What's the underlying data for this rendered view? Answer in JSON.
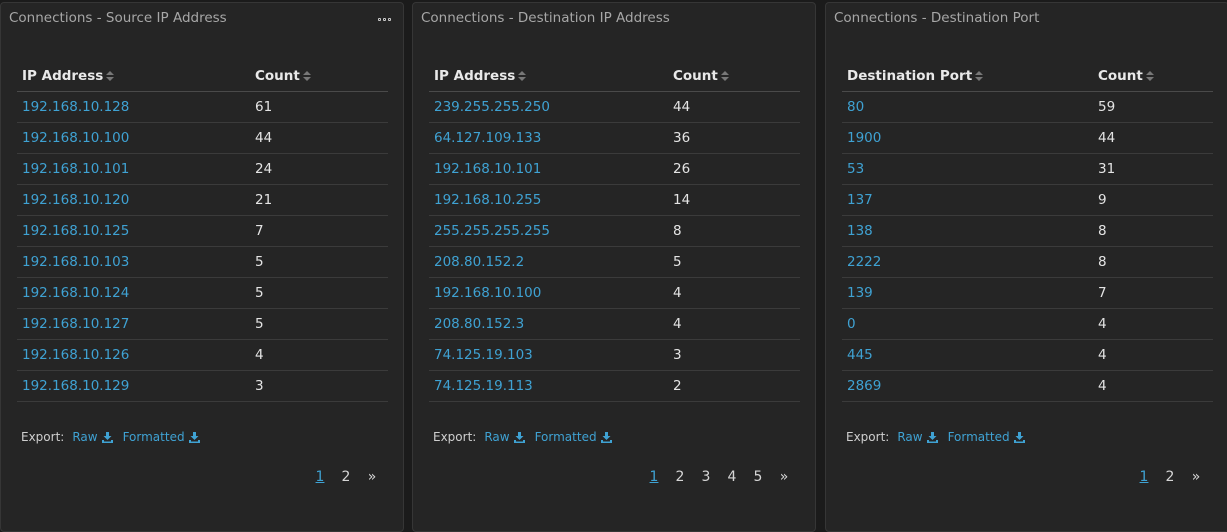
{
  "colors": {
    "accent": "#3fa2d3",
    "panel_bg": "#252525",
    "page_bg": "#1b1b1b"
  },
  "panels": [
    {
      "title": "Connections - Source IP Address",
      "col1": "IP Address",
      "col2": "Count",
      "rows": [
        [
          "192.168.10.128",
          "61"
        ],
        [
          "192.168.10.100",
          "44"
        ],
        [
          "192.168.10.101",
          "24"
        ],
        [
          "192.168.10.120",
          "21"
        ],
        [
          "192.168.10.125",
          "7"
        ],
        [
          "192.168.10.103",
          "5"
        ],
        [
          "192.168.10.124",
          "5"
        ],
        [
          "192.168.10.127",
          "5"
        ],
        [
          "192.168.10.126",
          "4"
        ],
        [
          "192.168.10.129",
          "3"
        ]
      ],
      "export_label": "Export:",
      "raw": "Raw",
      "formatted": "Formatted",
      "pages": [
        "1",
        "2",
        "»"
      ]
    },
    {
      "title": "Connections - Destination IP Address",
      "col1": "IP Address",
      "col2": "Count",
      "rows": [
        [
          "239.255.255.250",
          "44"
        ],
        [
          "64.127.109.133",
          "36"
        ],
        [
          "192.168.10.101",
          "26"
        ],
        [
          "192.168.10.255",
          "14"
        ],
        [
          "255.255.255.255",
          "8"
        ],
        [
          "208.80.152.2",
          "5"
        ],
        [
          "192.168.10.100",
          "4"
        ],
        [
          "208.80.152.3",
          "4"
        ],
        [
          "74.125.19.103",
          "3"
        ],
        [
          "74.125.19.113",
          "2"
        ]
      ],
      "export_label": "Export:",
      "raw": "Raw",
      "formatted": "Formatted",
      "pages": [
        "1",
        "2",
        "3",
        "4",
        "5",
        "»"
      ]
    },
    {
      "title": "Connections - Destination Port",
      "col1": "Destination Port",
      "col2": "Count",
      "rows": [
        [
          "80",
          "59"
        ],
        [
          "1900",
          "44"
        ],
        [
          "53",
          "31"
        ],
        [
          "137",
          "9"
        ],
        [
          "138",
          "8"
        ],
        [
          "2222",
          "8"
        ],
        [
          "139",
          "7"
        ],
        [
          "0",
          "4"
        ],
        [
          "445",
          "4"
        ],
        [
          "2869",
          "4"
        ]
      ],
      "export_label": "Export:",
      "raw": "Raw",
      "formatted": "Formatted",
      "pages": [
        "1",
        "2",
        "»"
      ]
    }
  ]
}
